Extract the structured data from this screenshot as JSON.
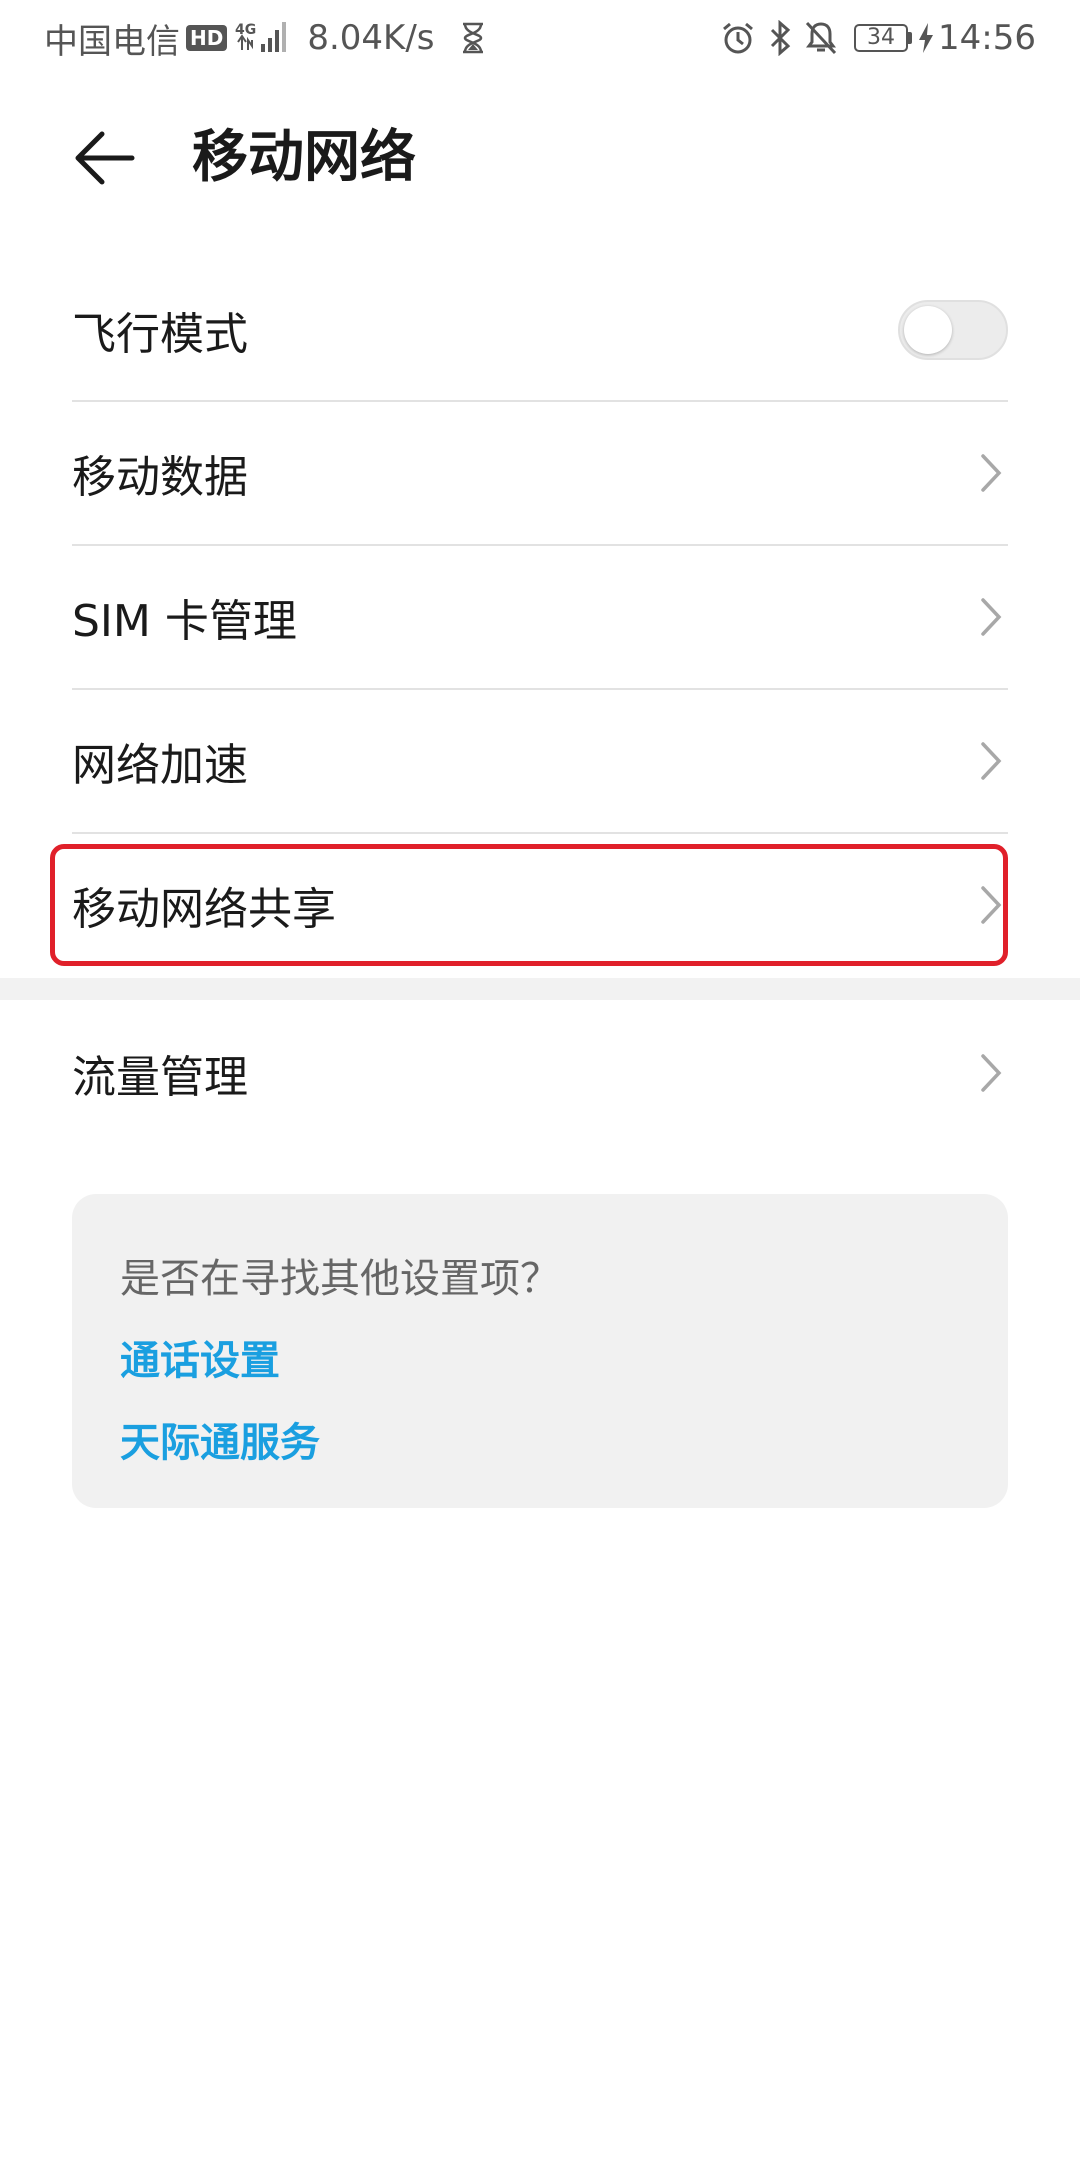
{
  "status_bar": {
    "carrier": "中国电信",
    "hd_badge": "HD",
    "network_type": "4G",
    "speed": "8.04K/s",
    "battery": "34",
    "time": "14:56",
    "icons": [
      "signal-icon",
      "hourglass-icon",
      "alarm-icon",
      "bluetooth-icon",
      "mute-icon",
      "battery-icon",
      "charging-icon"
    ]
  },
  "header": {
    "title": "移动网络",
    "back_icon": "back-arrow-icon"
  },
  "list": {
    "items": [
      {
        "label": "飞行模式",
        "control": "toggle",
        "toggle_on": false
      },
      {
        "label": "移动数据",
        "control": "chevron"
      },
      {
        "label": "SIM 卡管理",
        "control": "chevron"
      },
      {
        "label": "网络加速",
        "control": "chevron"
      },
      {
        "label": "移动网络共享",
        "control": "chevron",
        "highlighted": true
      },
      {
        "label": "流量管理",
        "control": "chevron"
      }
    ]
  },
  "suggestions": {
    "title": "是否在寻找其他设置项？",
    "links": [
      "通话设置",
      "天际通服务"
    ]
  },
  "colors": {
    "link": "#1a9fe0",
    "highlight_border": "#e0202a",
    "card_bg": "#f1f1f1",
    "divider": "#e2e2e2"
  }
}
